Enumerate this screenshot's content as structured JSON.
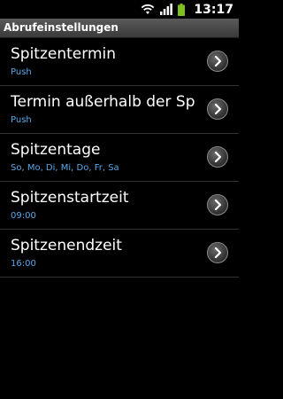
{
  "status_bar": {
    "time": "13:17",
    "icons": [
      "wifi-icon",
      "signal-icon",
      "battery-icon"
    ],
    "battery_color": "#7ec020"
  },
  "title_bar": {
    "title": "Abrufeinstellungen"
  },
  "colors": {
    "accent": "#5aa7ea",
    "background": "#000000"
  },
  "settings": {
    "items": [
      {
        "title": "Spitzentermin",
        "summary": "Push"
      },
      {
        "title": "Termin außerhalb der Sp",
        "summary": "Push"
      },
      {
        "title": "Spitzentage",
        "summary": "So, Mo, Di, Mi, Do, Fr, Sa"
      },
      {
        "title": "Spitzenstartzeit",
        "summary": "09:00"
      },
      {
        "title": "Spitzenendzeit",
        "summary": "16:00"
      }
    ]
  }
}
